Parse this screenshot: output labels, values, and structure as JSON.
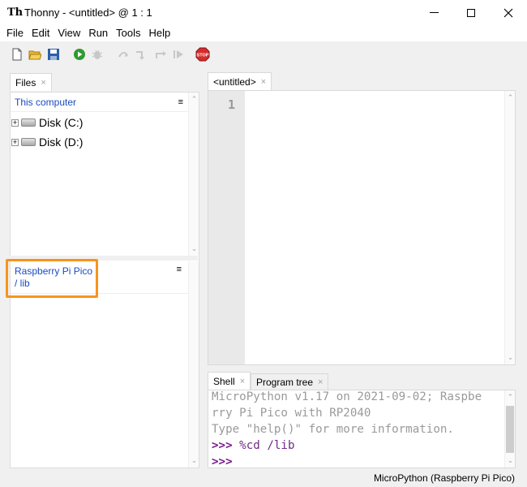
{
  "window": {
    "logo": "Th",
    "title": "Thonny  -  <untitled>  @  1 : 1",
    "controls": [
      "minimize",
      "maximize",
      "close"
    ]
  },
  "menu": {
    "items": [
      "File",
      "Edit",
      "View",
      "Run",
      "Tools",
      "Help"
    ]
  },
  "toolbar": {
    "icons": [
      "new-file-icon",
      "open-file-icon",
      "save-icon",
      "run-icon",
      "debug-icon",
      "step-over-icon",
      "step-into-icon",
      "step-out-icon",
      "resume-icon",
      "stop-icon"
    ],
    "stop_label": "STOP"
  },
  "files_panel": {
    "tab_label": "Files",
    "tab_close": "×",
    "computer_header": "This computer",
    "menu_glyph": "≡",
    "drives": [
      {
        "label": "Disk (C:)",
        "expander": "+"
      },
      {
        "label": "Disk (D:)",
        "expander": "+"
      }
    ],
    "device_header_line1": "Raspberry Pi Pico",
    "device_header_line2": "/ lib"
  },
  "editor": {
    "tab_label": "<untitled>",
    "tab_close": "×",
    "line_numbers": [
      "1"
    ]
  },
  "bottom_tabs": {
    "shell_label": "Shell",
    "program_tree_label": "Program tree",
    "close_glyph": "×"
  },
  "shell": {
    "line1": "MicroPython v1.17 on 2021-09-02; Raspbe",
    "line2": "rry Pi Pico with RP2040",
    "line3": "Type \"help()\" for more information.",
    "prompt": ">>>",
    "command": " %cd /lib"
  },
  "statusbar": {
    "interpreter": "MicroPython (Raspberry Pi Pico)"
  },
  "colors": {
    "highlight": "#f7941d",
    "header_blue": "#1a4bc1",
    "prompt_purple": "#7a1d8c"
  }
}
